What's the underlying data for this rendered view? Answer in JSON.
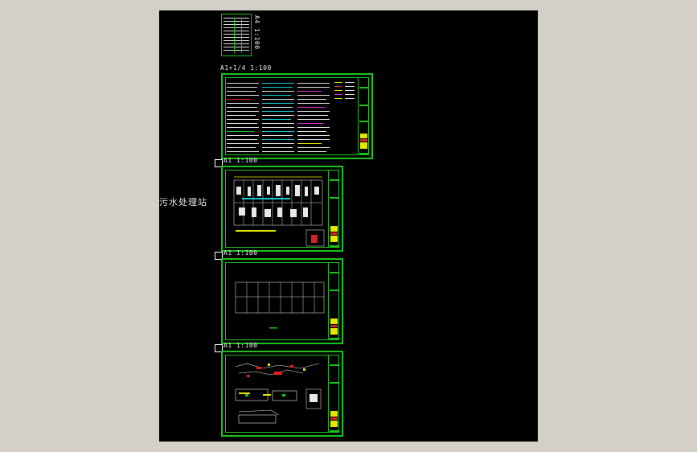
{
  "drawing": {
    "site_label": "污水处理站",
    "scale_labels": {
      "index_sheet": "A4 1:100",
      "notes_sheet": "A1+1/4 1:100",
      "plan_sheet": "A1 1:100",
      "structure_sheet": "A1 1:100",
      "section_sheet": "A1 1:100"
    }
  },
  "colors": {
    "background": "#000000",
    "frame": "#19c319",
    "canvas_border": "#d4d0c8",
    "text": "#e8e8e8",
    "accent_yellow": "#e6e600",
    "accent_red": "#e02020",
    "accent_cyan": "#19c8d0",
    "accent_magenta": "#d02cd0"
  }
}
